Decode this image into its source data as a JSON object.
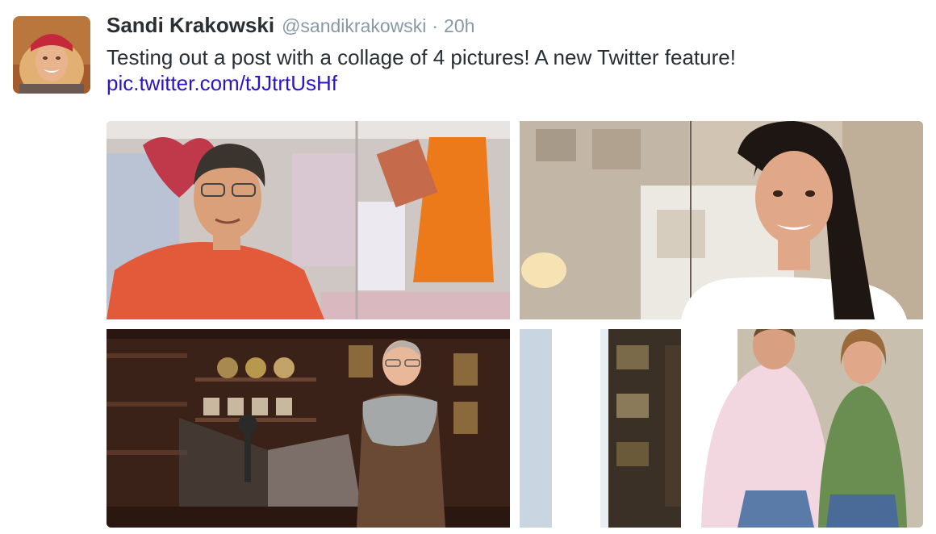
{
  "tweet": {
    "author_name": "Sandi Krakowski",
    "handle": "@sandikrakowski",
    "separator": "·",
    "timestamp": "20h",
    "text": "Testing out a post with a collage of 4 pictures! A new Twitter feature!",
    "link_text": "pic.twitter.com/tJJtrtUsHf"
  },
  "photos": [
    {
      "subject": "man-in-clothing-shop"
    },
    {
      "subject": "woman-in-boutique"
    },
    {
      "subject": "shopkeeper-in-tea-shop"
    },
    {
      "subject": "couple-at-storefront"
    }
  ],
  "colors": {
    "name": "#292f33",
    "meta": "#8899a6",
    "link": "#2b15c4",
    "background": "#ffffff"
  }
}
